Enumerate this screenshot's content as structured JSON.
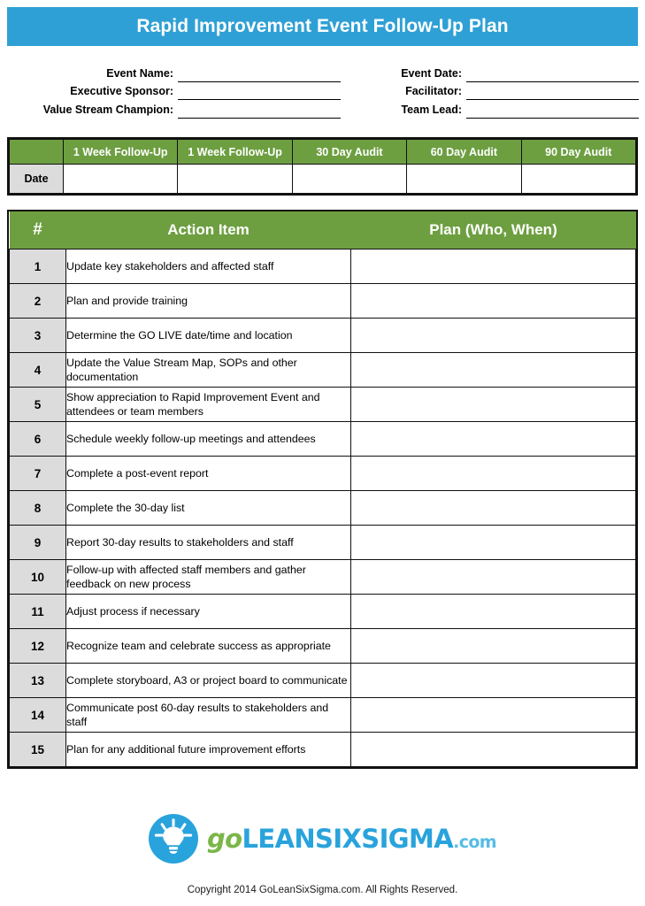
{
  "header": {
    "title": "Rapid Improvement Event Follow-Up Plan",
    "banner_color": "#2FA0D5"
  },
  "meta": {
    "left_fields": [
      {
        "label": "Event Name:",
        "value": ""
      },
      {
        "label": "Executive Sponsor:",
        "value": ""
      },
      {
        "label": "Value Stream Champion:",
        "value": ""
      }
    ],
    "right_fields": [
      {
        "label": "Event Date:",
        "value": ""
      },
      {
        "label": "Facilitator:",
        "value": ""
      },
      {
        "label": "Team Lead:",
        "value": ""
      }
    ]
  },
  "date_table": {
    "corner_label": "",
    "columns": [
      "1 Week Follow-Up",
      "1 Week Follow-Up",
      "30 Day Audit",
      "60 Day Audit",
      "90 Day Audit"
    ],
    "row_label": "Date",
    "row_values": [
      "",
      "",
      "",
      "",
      ""
    ],
    "header_color": "#6D9F41",
    "label_cell_color": "#DCDCDC"
  },
  "action_table": {
    "headers": {
      "number": "#",
      "item": "Action Item",
      "plan": "Plan (Who, When)"
    },
    "header_color": "#6D9F41",
    "number_cell_color": "#DCDCDC",
    "rows": [
      {
        "num": "1",
        "item": "Update key stakeholders and affected staff",
        "plan": ""
      },
      {
        "num": "2",
        "item": "Plan and provide training",
        "plan": ""
      },
      {
        "num": "3",
        "item": "Determine the GO LIVE date/time and location",
        "plan": ""
      },
      {
        "num": "4",
        "item": "Update the Value Stream Map, SOPs and other documentation",
        "plan": ""
      },
      {
        "num": "5",
        "item": "Show appreciation to Rapid Improvement Event and attendees or team members",
        "plan": ""
      },
      {
        "num": "6",
        "item": "Schedule weekly follow-up meetings and attendees",
        "plan": ""
      },
      {
        "num": "7",
        "item": "Complete a post-event report",
        "plan": ""
      },
      {
        "num": "8",
        "item": "Complete the 30-day list",
        "plan": ""
      },
      {
        "num": "9",
        "item": "Report 30-day results to stakeholders and staff",
        "plan": ""
      },
      {
        "num": "10",
        "item": "Follow-up with affected staff members and gather feedback on new process",
        "plan": ""
      },
      {
        "num": "11",
        "item": "Adjust process if necessary",
        "plan": ""
      },
      {
        "num": "12",
        "item": "Recognize team and celebrate success as appropriate",
        "plan": ""
      },
      {
        "num": "13",
        "item": "Complete storyboard, A3 or project board to communicate",
        "plan": ""
      },
      {
        "num": "14",
        "item": "Communicate post 60-day results to stakeholders and staff",
        "plan": ""
      },
      {
        "num": "15",
        "item": "Plan for any additional future improvement efforts",
        "plan": ""
      }
    ]
  },
  "logo": {
    "icon": "lightbulb-icon",
    "circle_color": "#29A3DC",
    "bulb_color": "#FFFFFF",
    "word_go": "go",
    "word_main": "LEANSIXSIGMA",
    "word_com": ".com",
    "go_color": "#7AB648",
    "main_color": "#29A3DC",
    "com_color": "#55BCE6"
  },
  "footer": {
    "copyright": "Copyright 2014 GoLeanSixSigma.com. All Rights Reserved."
  }
}
